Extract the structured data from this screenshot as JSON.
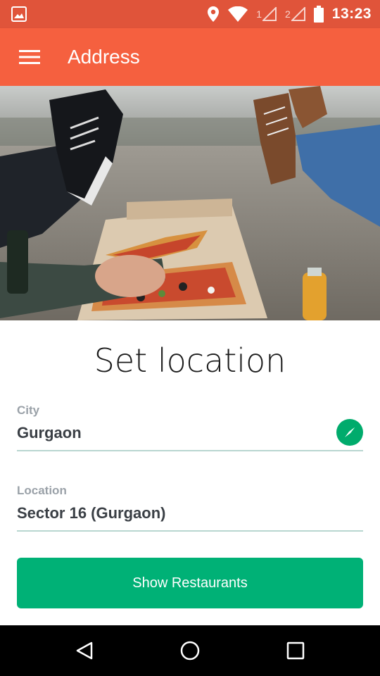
{
  "status_bar": {
    "time": "13:23",
    "sim1": "1",
    "sim2": "2",
    "icons": [
      "image-icon",
      "location-icon",
      "wifi-icon",
      "signal-icon",
      "signal-icon",
      "battery-icon"
    ]
  },
  "app_bar": {
    "title": "Address",
    "menu_icon": "menu-icon",
    "color": "#f5603f"
  },
  "hero": {
    "image": "people-eating-pizza-photo"
  },
  "form": {
    "headline": "Set location",
    "city": {
      "label": "City",
      "value": "Gurgaon",
      "action_icon": "compass-icon"
    },
    "location": {
      "label": "Location",
      "value": "Sector 16 (Gurgaon)"
    },
    "submit_label": "Show Restaurants",
    "accent": "#00b176"
  },
  "nav_bar": {
    "icons": [
      "back-icon",
      "home-icon",
      "recents-icon"
    ]
  }
}
